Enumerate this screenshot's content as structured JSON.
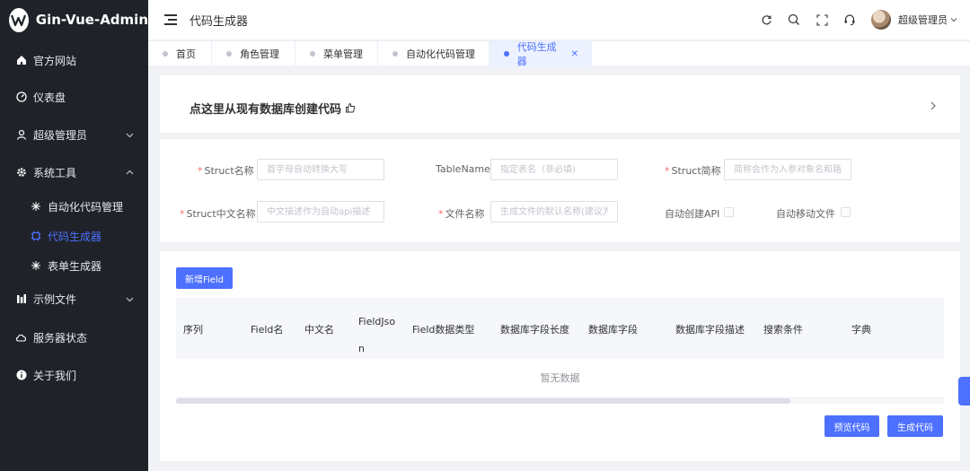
{
  "sidebar": {
    "brand": "Gin-Vue-Admin",
    "items": [
      {
        "label": "官方网站",
        "icon": "home-icon"
      },
      {
        "label": "仪表盘",
        "icon": "dashboard-icon"
      },
      {
        "label": "超级管理员",
        "icon": "user-icon",
        "expandable": true,
        "expanded": false
      },
      {
        "label": "系统工具",
        "icon": "gear-icon",
        "expandable": true,
        "expanded": true
      },
      {
        "label": "自动化代码管理",
        "icon": "sparkle-icon",
        "sub": true
      },
      {
        "label": "代码生成器",
        "icon": "cpu-icon",
        "sub": true,
        "active": true
      },
      {
        "label": "表单生成器",
        "icon": "sparkle-icon",
        "sub": true
      },
      {
        "label": "示例文件",
        "icon": "chart-icon",
        "expandable": true,
        "expanded": false
      },
      {
        "label": "服务器状态",
        "icon": "cloud-icon"
      },
      {
        "label": "关于我们",
        "icon": "info-icon"
      }
    ]
  },
  "header": {
    "title": "代码生成器",
    "user": "超级管理员"
  },
  "tabs": [
    {
      "label": "首页"
    },
    {
      "label": "角色管理"
    },
    {
      "label": "菜单管理"
    },
    {
      "label": "自动化代码管理"
    },
    {
      "label": "代码生成器",
      "active": true
    }
  ],
  "db_card": {
    "title": "点这里从现有数据库创建代码"
  },
  "form": {
    "struct_name": {
      "label": "Struct名称",
      "placeholder": "首字母自动转换大写",
      "value": ""
    },
    "table_name": {
      "label": "TableName",
      "placeholder": "指定表名（非必填)",
      "value": ""
    },
    "struct_abbr": {
      "label": "Struct简称",
      "placeholder": "简称会作为入参对象名和路由group",
      "value": ""
    },
    "struct_cn": {
      "label": "Struct中文名称",
      "placeholder": "中文描述作为自动api描述",
      "value": ""
    },
    "file_name": {
      "label": "文件名称",
      "placeholder": "生成文件的默认名称(建议为驼峰格式)",
      "value": ""
    },
    "auto_api": {
      "label": "自动创建API",
      "checked": false
    },
    "auto_move": {
      "label": "自动移动文件",
      "checked": false
    }
  },
  "fields": {
    "add_button": "新增Field",
    "columns": [
      "序列",
      "Field名",
      "中文名",
      "FieldJson",
      "Field数据类型",
      "数据库字段长度",
      "数据库字段",
      "数据库字段描述",
      "搜索条件",
      "字典"
    ],
    "rows": [],
    "empty_text": "暂无数据",
    "scroll_fraction": 0.8,
    "preview_button": "预览代码",
    "generate_button": "生成代码"
  }
}
